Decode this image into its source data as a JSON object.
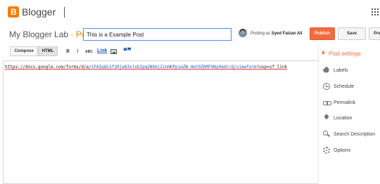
{
  "app": {
    "brand": "Blogger"
  },
  "header": {
    "blog_name": "My Blogger Lab",
    "separator": "·",
    "section": "Post",
    "post_title_value": "This is a Example Post",
    "posting_as_prefix": "Posting as",
    "author": "Syed Faizan Ali"
  },
  "actions": {
    "publish": "Publish",
    "save": "Save",
    "preview": "Pre"
  },
  "toolbar": {
    "compose": "Compose",
    "html": "HTML",
    "bold": "B",
    "italic": "I",
    "strike": "ABC",
    "link": "Link",
    "quote": "❝❞"
  },
  "editor": {
    "prefix": "https://docs.google.com/forms/d/e/",
    "highlight": "1FAIpQLSf1Rja83xlsbIpq2NXmj2znmKPpimZW_Het9ZbMFUNy0aUCcQ/viewform",
    "suffix": "?usp=sf_link"
  },
  "sidebar": {
    "heading": "Post settings",
    "items": [
      {
        "label": "Labels",
        "icon": "label-icon"
      },
      {
        "label": "Schedule",
        "icon": "clock-icon"
      },
      {
        "label": "Permalink",
        "icon": "link-icon"
      },
      {
        "label": "Location",
        "icon": "location-pin-icon"
      },
      {
        "label": "Search Description",
        "icon": "search-icon"
      },
      {
        "label": "Options",
        "icon": "gear-icon"
      }
    ]
  },
  "colors": {
    "accent": "#f36c3d",
    "brand": "#f57d00",
    "link": "#1a55c0"
  }
}
